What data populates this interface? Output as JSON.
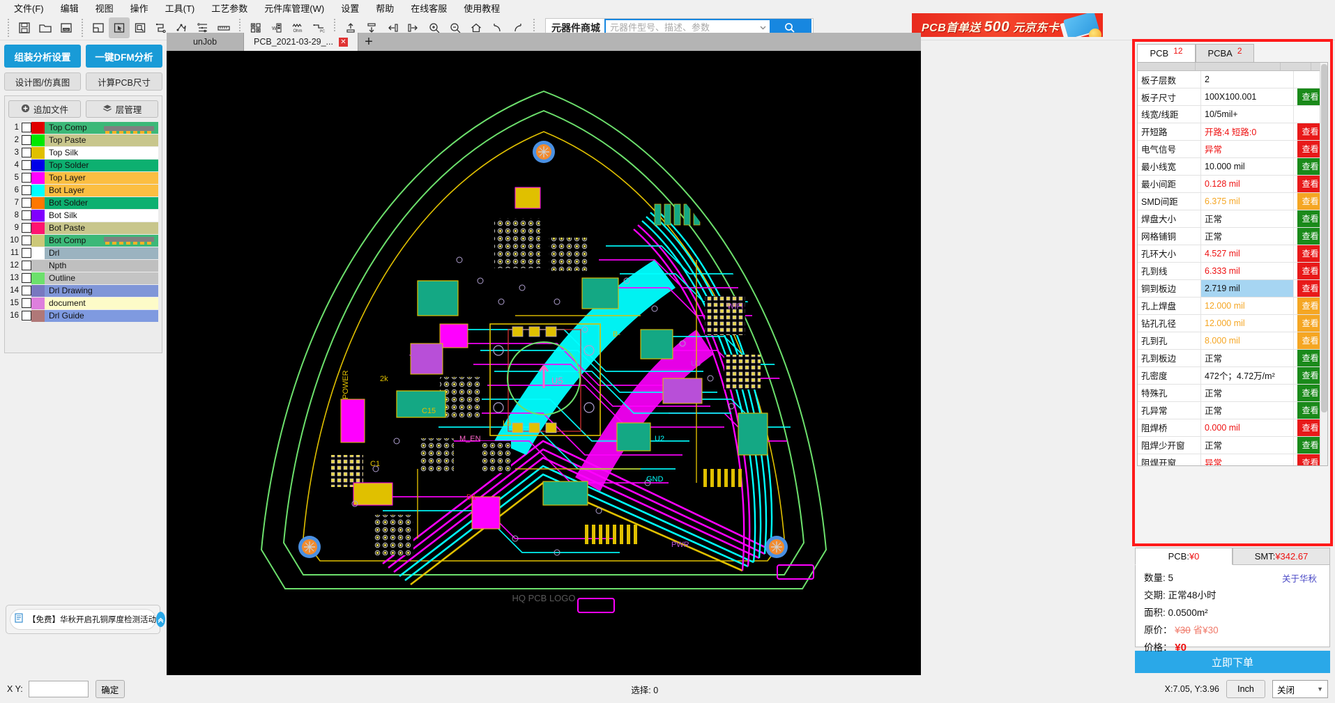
{
  "menu": {
    "items": [
      "文件(F)",
      "编辑",
      "视图",
      "操作",
      "工具(T)",
      "工艺参数",
      "元件库管理(W)",
      "设置",
      "帮助",
      "在线客服",
      "使用教程"
    ]
  },
  "toolbar": {
    "icons": [
      "save-icon",
      "open-folder-icon",
      "export-pdf-icon",
      "panel-layout-icon",
      "select-pointer-icon",
      "area-select-icon",
      "route-icon",
      "net-icon",
      "stackup-icon",
      "ruler-icon",
      "panelize-icon",
      "width-measure-icon",
      "impedance-icon",
      "dfm-icon",
      "align-top-icon",
      "align-bottom-icon",
      "align-left-icon",
      "align-right-icon",
      "zoom-in-icon",
      "zoom-out-icon",
      "home-icon",
      "undo-icon",
      "redo-icon"
    ]
  },
  "search": {
    "label": "元器件商城",
    "placeholder": "元器件型号、描述、参数",
    "value": "",
    "button_icon": "search-icon"
  },
  "banner": {
    "text_prefix": "PCB首单送",
    "text_big": "500",
    "text_suffix": "元京东卡"
  },
  "doc_tabs": {
    "tabs": [
      {
        "label": "unJob",
        "active": false,
        "closable": false
      },
      {
        "label": "PCB_2021-03-29_...",
        "active": true,
        "closable": true
      }
    ],
    "close_label": "✕",
    "add_label": "+"
  },
  "left": {
    "buttons_primary": [
      "组装分析设置",
      "一键DFM分析"
    ],
    "buttons_secondary": [
      "设计图/仿真图",
      "计算PCB尺寸"
    ],
    "layer_tools": [
      {
        "label": "追加文件",
        "icon": "plus-circle-icon"
      },
      {
        "label": "层管理",
        "icon": "layers-icon"
      }
    ],
    "layers": [
      {
        "n": "1",
        "name": "Top Comp",
        "swatch": "#e00000",
        "rowbg": "#3cb878",
        "chip": true
      },
      {
        "n": "2",
        "name": "Top Paste",
        "swatch": "#00e800",
        "rowbg": "#c8c68c",
        "chip": false
      },
      {
        "n": "3",
        "name": "Top Silk",
        "swatch": "#e0c000",
        "rowbg": "#ffffff",
        "chip": false
      },
      {
        "n": "4",
        "name": "Top Solder",
        "swatch": "#0000e8",
        "rowbg": "#0db070",
        "chip": false
      },
      {
        "n": "5",
        "name": "Top Layer",
        "swatch": "#ff00ff",
        "rowbg": "#fbbe42",
        "chip": false
      },
      {
        "n": "6",
        "name": "Bot Layer",
        "swatch": "#00ffff",
        "rowbg": "#fbbe42",
        "chip": false
      },
      {
        "n": "7",
        "name": "Bot Solder",
        "swatch": "#ff7700",
        "rowbg": "#0db070",
        "chip": false
      },
      {
        "n": "8",
        "name": "Bot Silk",
        "swatch": "#8000ff",
        "rowbg": "#ffffff",
        "chip": false
      },
      {
        "n": "9",
        "name": "Bot Paste",
        "swatch": "#ff1470",
        "rowbg": "#c8c68c",
        "chip": false
      },
      {
        "n": "10",
        "name": "Bot Comp",
        "swatch": "#ccc878",
        "rowbg": "#3cb878",
        "chip": true
      },
      {
        "n": "11",
        "name": "Drl",
        "swatch": "#ffffff",
        "rowbg": "#9bb3c0",
        "chip": false
      },
      {
        "n": "12",
        "name": "Npth",
        "swatch": "#c0c0c0",
        "rowbg": "#bfbfbf",
        "chip": false
      },
      {
        "n": "13",
        "name": "Outline",
        "swatch": "#6ce06c",
        "rowbg": "#c4c4c4",
        "chip": false
      },
      {
        "n": "14",
        "name": "Drl Drawing",
        "swatch": "#7878c0",
        "rowbg": "#8096d8",
        "chip": false
      },
      {
        "n": "15",
        "name": "document",
        "swatch": "#dd7fdd",
        "rowbg": "#fdfbc8",
        "chip": false
      },
      {
        "n": "16",
        "name": "Drl Guide",
        "swatch": "#b07878",
        "rowbg": "#7f9ae0",
        "chip": false
      }
    ],
    "promo": {
      "icon": "document-icon",
      "text": "【免费】华秋开启孔铜厚度检测活动",
      "collapse_icon": "chevron-up-icon"
    }
  },
  "right": {
    "tabs": [
      {
        "label": "PCB",
        "badge": "12",
        "active": true
      },
      {
        "label": "PCBA",
        "badge": "2",
        "active": false
      }
    ],
    "action_label": "查看",
    "rows": [
      {
        "key": "板子层数",
        "value": "2",
        "value_color": "normal",
        "action": "none",
        "highlight": false
      },
      {
        "key": "板子尺寸",
        "value": "100X100.001",
        "value_color": "normal",
        "action": "green",
        "highlight": false
      },
      {
        "key": "线宽/线距",
        "value": "10/5mil+",
        "value_color": "normal",
        "action": "none",
        "highlight": false
      },
      {
        "key": "开短路",
        "value": "开路:4 短路:0",
        "value_color": "red",
        "action": "red",
        "highlight": false
      },
      {
        "key": "电气信号",
        "value": "异常",
        "value_color": "red",
        "action": "red",
        "highlight": false
      },
      {
        "key": "最小线宽",
        "value": "10.000 mil",
        "value_color": "normal",
        "action": "green",
        "highlight": false
      },
      {
        "key": "最小间距",
        "value": "0.128 mil",
        "value_color": "red",
        "action": "red",
        "highlight": false
      },
      {
        "key": "SMD间距",
        "value": "6.375 mil",
        "value_color": "orange",
        "action": "orange",
        "highlight": false
      },
      {
        "key": "焊盘大小",
        "value": "正常",
        "value_color": "normal",
        "action": "green",
        "highlight": false
      },
      {
        "key": "网格铺铜",
        "value": "正常",
        "value_color": "normal",
        "action": "green",
        "highlight": false
      },
      {
        "key": "孔环大小",
        "value": "4.527 mil",
        "value_color": "red",
        "action": "red",
        "highlight": false
      },
      {
        "key": "孔到线",
        "value": "6.333 mil",
        "value_color": "red",
        "action": "red",
        "highlight": false
      },
      {
        "key": "铜到板边",
        "value": "2.719 mil",
        "value_color": "normal",
        "action": "red",
        "highlight": true
      },
      {
        "key": "孔上焊盘",
        "value": "12.000 mil",
        "value_color": "orange",
        "action": "orange",
        "highlight": false
      },
      {
        "key": "钻孔孔径",
        "value": "12.000 mil",
        "value_color": "orange",
        "action": "orange",
        "highlight": false
      },
      {
        "key": "孔到孔",
        "value": "8.000 mil",
        "value_color": "orange",
        "action": "orange",
        "highlight": false
      },
      {
        "key": "孔到板边",
        "value": "正常",
        "value_color": "normal",
        "action": "green",
        "highlight": false
      },
      {
        "key": "孔密度",
        "value": "472个；4.72万/m²",
        "value_color": "normal",
        "action": "green",
        "highlight": false
      },
      {
        "key": "特殊孔",
        "value": "正常",
        "value_color": "normal",
        "action": "green",
        "highlight": false
      },
      {
        "key": "孔异常",
        "value": "正常",
        "value_color": "normal",
        "action": "green",
        "highlight": false
      },
      {
        "key": "阻焊桥",
        "value": "0.000 mil",
        "value_color": "red",
        "action": "red",
        "highlight": false
      },
      {
        "key": "阻焊少开窗",
        "value": "正常",
        "value_color": "normal",
        "action": "green",
        "highlight": false
      },
      {
        "key": "阻焊开窗",
        "value": "异常",
        "value_color": "red",
        "action": "red",
        "highlight": false
      }
    ]
  },
  "price": {
    "tabs": [
      {
        "prefix": "PCB:",
        "amount": "¥0",
        "active": true
      },
      {
        "prefix": "SMT:",
        "amount": "¥342.67",
        "active": false
      }
    ],
    "about_link": "关于华秋",
    "quantity_label": "数量:",
    "quantity_value": "5",
    "leadtime_label": "交期:",
    "leadtime_value": "正常48小时",
    "area_label": "面积:",
    "area_value": "0.0500m²",
    "original_label": "原价：",
    "original_value": "¥30",
    "save_label": "省",
    "save_value": "¥30",
    "price_label": "价格：",
    "price_value": "¥0",
    "order_button": "立即下单"
  },
  "status": {
    "xy_label": "X Y:",
    "xy_value": "",
    "confirm_label": "确定",
    "selection_label": "选择:",
    "selection_count": "0",
    "coordinates": "X:7.05, Y:3.96",
    "unit": "Inch",
    "mode": "关闭"
  },
  "canvas": {
    "description": "pcb-gerber-view",
    "board_outline_color": "#6ce06c",
    "top_layer_color": "#ff00ff",
    "bot_layer_color": "#00ffff",
    "silk_color": "#e0c000",
    "background": "#000000",
    "center_marker": "up-arrow-icon",
    "designators": [
      "U5",
      "U2",
      "U3",
      "J5",
      "D1",
      "C15",
      "C1",
      "L6",
      "PWR",
      "2k",
      "POWER",
      "M_EN",
      "B-",
      "GND",
      "WIFI"
    ],
    "mounting_holes": 3
  }
}
